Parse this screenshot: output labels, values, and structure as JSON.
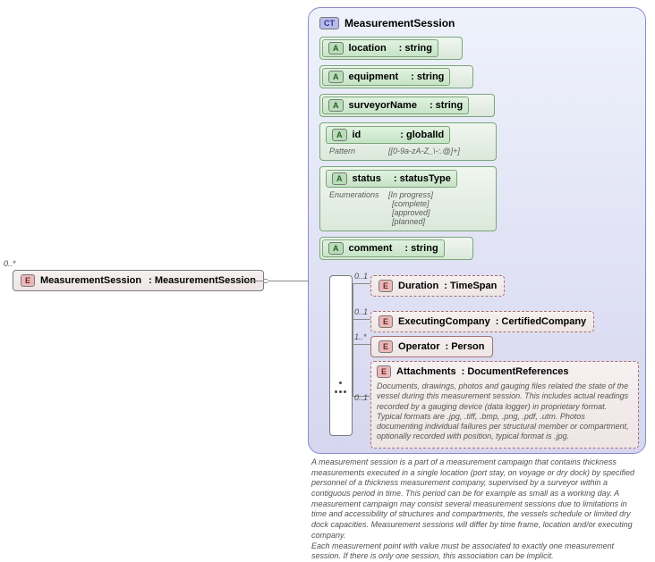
{
  "root": {
    "mult": "0..*",
    "name": "MeasurementSession",
    "type": ": MeasurementSession"
  },
  "ct": {
    "title": "MeasurementSession",
    "attrs": {
      "location": {
        "name": "location",
        "type": ": string"
      },
      "equipment": {
        "name": "equipment",
        "type": ": string"
      },
      "surveyor": {
        "name": "surveyorName",
        "type": ": string"
      },
      "id": {
        "name": "id",
        "type": ": globalId",
        "patternLabel": "Pattern",
        "pattern": "[[0-9a-zA-Z_\\-:.@]+]"
      },
      "status": {
        "name": "status",
        "type": ": statusType",
        "enumLabel": "Enumerations",
        "enums": [
          "[In progress]",
          "[complete]",
          "[approved]",
          "[planned]"
        ]
      },
      "comment": {
        "name": "comment",
        "type": ": string"
      }
    },
    "children": {
      "duration": {
        "mult": "0..1",
        "name": "Duration",
        "type": ": TimeSpan"
      },
      "execCo": {
        "mult": "0..1",
        "name": "ExecutingCompany",
        "type": ": CertifiedCompany"
      },
      "operator": {
        "mult": "1..*",
        "name": "Operator",
        "type": ": Person"
      },
      "attachments": {
        "mult": "0..1",
        "name": "Attachments",
        "type": ": DocumentReferences",
        "desc": "Documents, drawings, photos and gauging files related the state of the vessel during this measurement session. This includes actual readings recorded by a gauging device (data logger) in\n    proprietary format. Typical formats are .jpg, .tiff, .bmp, .png, .pdf, .utm. Photos documenting individual failures per structural member or compartment, optionally recorded with position, typical format is .jpg."
      }
    },
    "description": "A measurement session is a part of a measurement campaign that contains thickness measurements executed in a single location (port stay, on voyage or dry dock) by specified personnel of a thickness measurement company, supervised by a surveyor within a contiguous period in time. This period can be for example as small as a working day. A measurement campaign may consist several measurement sessions due to limitations in time and accessibility of structures and compartments, the vessels schedule or limited dry dock capacities. Measurement sessions will differ by time frame, location and/or executing company.\nEach measurement point with value must be associated to exactly one measurement session. If there is only one session, this association can be implicit."
  }
}
